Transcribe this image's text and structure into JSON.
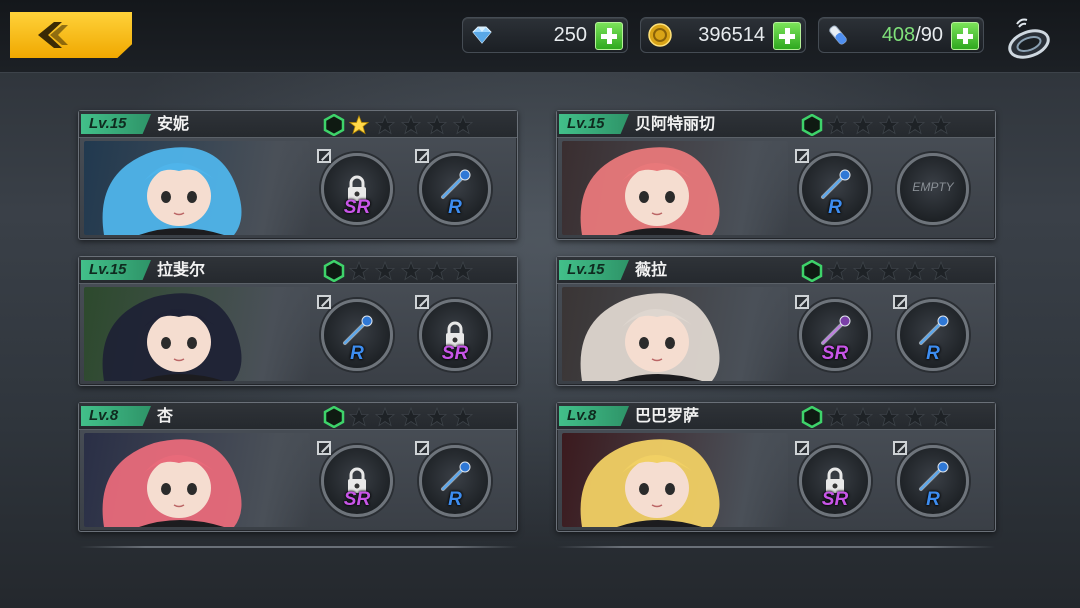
{
  "header": {
    "resources": [
      {
        "icon": "diamond-icon",
        "value": "250"
      },
      {
        "icon": "gold-coin-icon",
        "value": "396514"
      },
      {
        "icon": "stamina-potion-icon",
        "current": "408",
        "max": "/90"
      }
    ]
  },
  "cards": [
    {
      "level": "Lv.15",
      "name": "安妮",
      "stars": 1,
      "slots": [
        {
          "rarity": "SR",
          "locked": true,
          "icon": "locked-weapon-icon"
        },
        {
          "rarity": "R",
          "locked": false,
          "icon": "blue-staff-icon"
        }
      ],
      "colors": {
        "hair": "#4fb4ea",
        "bg": "#21394f"
      }
    },
    {
      "level": "Lv.15",
      "name": "贝阿特丽切",
      "stars": 0,
      "slots": [
        {
          "rarity": "R",
          "locked": false,
          "icon": "sword-icon"
        },
        {
          "rarity": "",
          "locked": false,
          "empty": true,
          "empty_label": "EMPTY"
        }
      ],
      "colors": {
        "hair": "#e8787a",
        "bg": "#3a2e30"
      }
    },
    {
      "level": "Lv.15",
      "name": "拉斐尔",
      "stars": 0,
      "slots": [
        {
          "rarity": "R",
          "locked": false,
          "icon": "dual-axe-icon"
        },
        {
          "rarity": "SR",
          "locked": true,
          "icon": "locked-weapon-icon"
        }
      ],
      "colors": {
        "hair": "#1f2235",
        "bg": "#2d4a2d"
      }
    },
    {
      "level": "Lv.15",
      "name": "薇拉",
      "stars": 0,
      "slots": [
        {
          "rarity": "SR",
          "locked": false,
          "icon": "death-note-icon"
        },
        {
          "rarity": "R",
          "locked": false,
          "icon": "gauntlet-icon"
        }
      ],
      "colors": {
        "hair": "#ded6cf",
        "bg": "#3a3535"
      }
    },
    {
      "level": "Lv.8",
      "name": "杏",
      "stars": 0,
      "slots": [
        {
          "rarity": "SR",
          "locked": true,
          "icon": "locked-weapon-icon"
        },
        {
          "rarity": "R",
          "locked": false,
          "icon": "scythe-icon"
        }
      ],
      "colors": {
        "hair": "#e86a7a",
        "bg": "#2a2f46"
      }
    },
    {
      "level": "Lv.8",
      "name": "巴巴罗萨",
      "stars": 0,
      "slots": [
        {
          "rarity": "SR",
          "locked": true,
          "icon": "locked-weapon-icon"
        },
        {
          "rarity": "R",
          "locked": false,
          "icon": "dual-swords-icon"
        }
      ],
      "colors": {
        "hair": "#f1d064",
        "bg": "#3b1a1e"
      }
    }
  ]
}
